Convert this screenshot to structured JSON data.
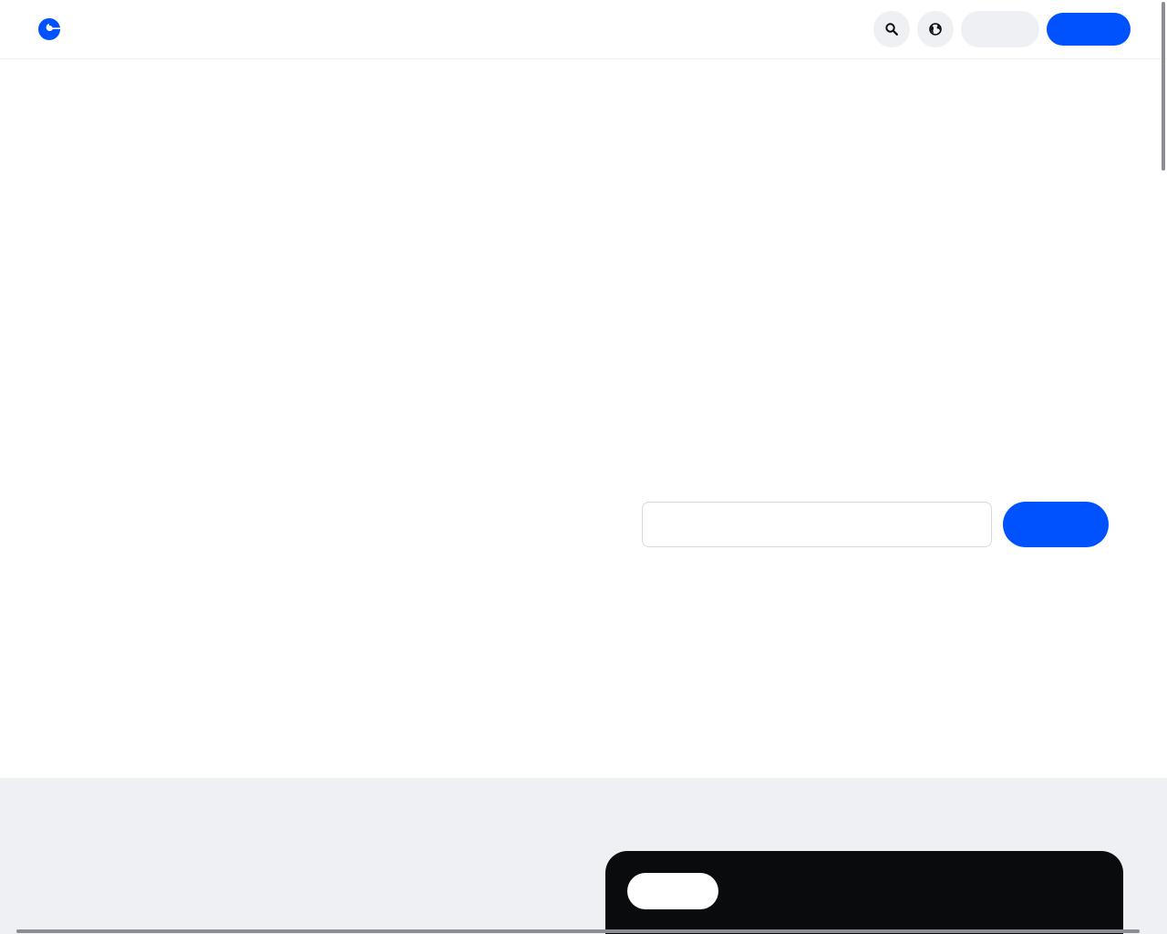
{
  "header": {
    "logo_icon": "coinbase-c-logo-icon",
    "search_icon": "search-icon",
    "globe_icon": "globe-icon",
    "signin_label": "",
    "signup_label": ""
  },
  "hero": {
    "email_value": "",
    "email_placeholder": "",
    "cta_label": ""
  },
  "card": {
    "pill_label": ""
  },
  "colors": {
    "brand_blue": "#0052ff",
    "light_gray": "#eef0f3",
    "dark": "#0a0b0d",
    "white": "#ffffff"
  }
}
